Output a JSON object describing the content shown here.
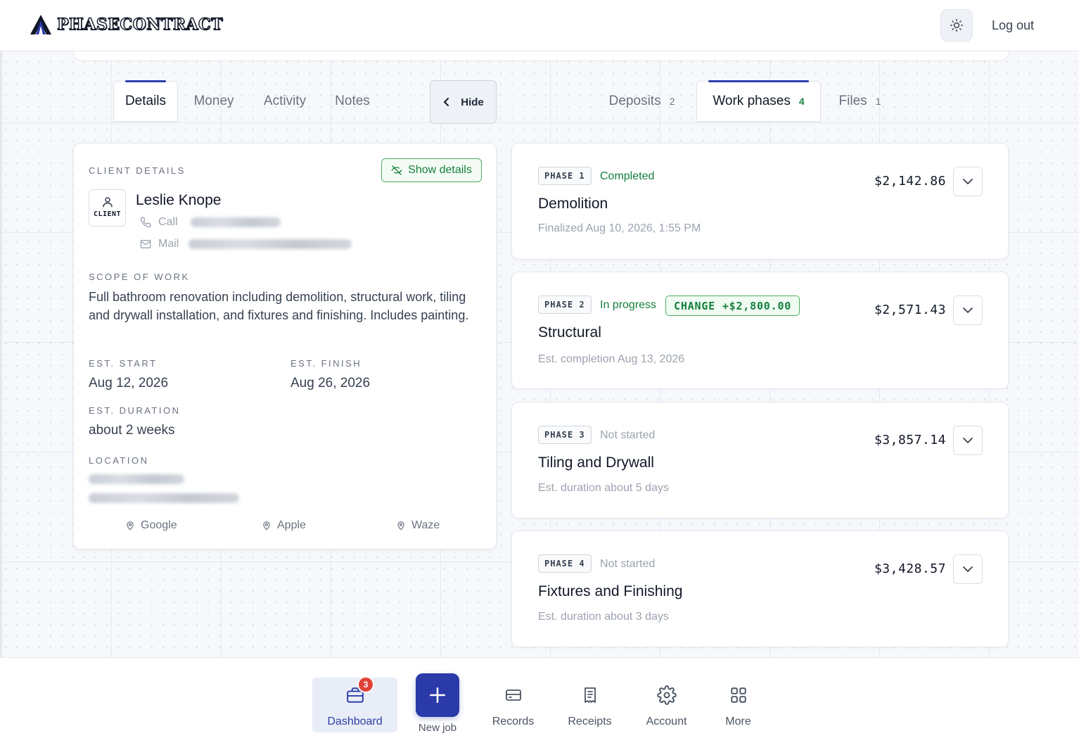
{
  "app": {
    "logo_text": "PHASECONTRACT",
    "logout_label": "Log out"
  },
  "tabs_left": [
    {
      "label": "Details",
      "active": true
    },
    {
      "label": "Money",
      "active": false
    },
    {
      "label": "Activity",
      "active": false
    },
    {
      "label": "Notes",
      "active": false
    }
  ],
  "hide_label": "Hide",
  "tabs_right": [
    {
      "label": "Deposits",
      "count": "2",
      "active": false
    },
    {
      "label": "Work phases",
      "count": "4",
      "active": true
    },
    {
      "label": "Files",
      "count": "1",
      "active": false
    }
  ],
  "client": {
    "section_label": "CLIENT DETAILS",
    "show_details_label": "Show details",
    "badge_label": "CLIENT",
    "name": "Leslie Knope",
    "call_label": "Call",
    "mail_label": "Mail",
    "scope_label": "SCOPE OF WORK",
    "scope_text": "Full bathroom renovation including demolition, structural work, tiling and drywall installation, and fixtures and finishing. Includes painting.",
    "est_start_label": "EST. START",
    "est_start": "Aug 12, 2026",
    "est_finish_label": "EST. FINISH",
    "est_finish": "Aug 26, 2026",
    "est_duration_label": "EST. DURATION",
    "est_duration": "about 2 weeks",
    "location_label": "LOCATION",
    "maps": [
      "Google",
      "Apple",
      "Waze"
    ]
  },
  "phases": [
    {
      "badge": "PHASE 1",
      "status": "Completed",
      "status_color": "#15803d",
      "change": "",
      "title": "Demolition",
      "sub": "Finalized Aug 10, 2026, 1:55 PM",
      "amount": "$2,142.86"
    },
    {
      "badge": "PHASE 2",
      "status": "In progress",
      "status_color": "#15803d",
      "change": "CHANGE +$2,800.00",
      "title": "Structural",
      "sub": "Est. completion Aug 13, 2026",
      "amount": "$2,571.43"
    },
    {
      "badge": "PHASE 3",
      "status": "Not started",
      "status_color": "#9ca3af",
      "change": "",
      "title": "Tiling and Drywall",
      "sub": "Est. duration about 5 days",
      "amount": "$3,857.14"
    },
    {
      "badge": "PHASE 4",
      "status": "Not started",
      "status_color": "#9ca3af",
      "change": "",
      "title": "Fixtures and Finishing",
      "sub": "Est. duration about 3 days",
      "amount": "$3,428.57"
    }
  ],
  "nav": {
    "dashboard": "Dashboard",
    "dashboard_badge": "3",
    "new_job": "New job",
    "records": "Records",
    "receipts": "Receipts",
    "account": "Account",
    "more": "More"
  },
  "colors": {
    "accent": "#2a3aa8",
    "success": "#15803d",
    "badge_red": "#e0433a"
  }
}
